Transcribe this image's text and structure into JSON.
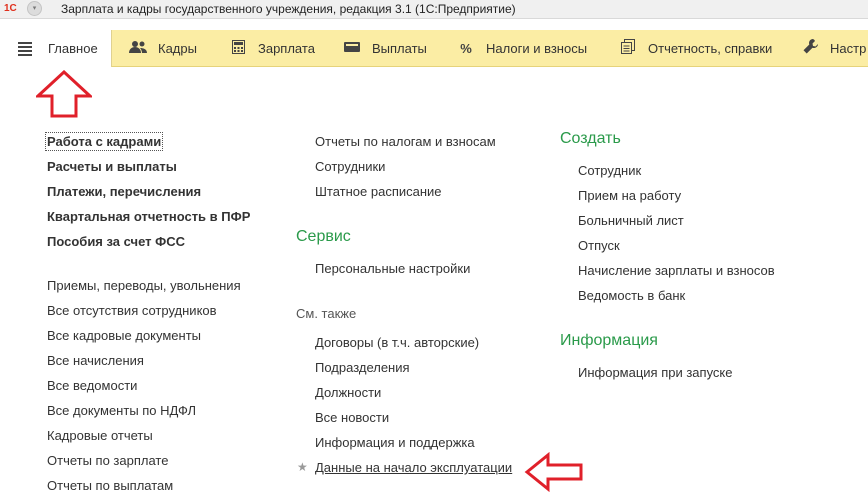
{
  "window": {
    "title": "Зарплата и кадры государственного учреждения, редакция 3.1  (1С:Предприятие)",
    "logo_text": "1С"
  },
  "sections": [
    {
      "label": "Главное",
      "icon": "menu-lines-icon"
    },
    {
      "label": "Кадры",
      "icon": "people-icon"
    },
    {
      "label": "Зарплата",
      "icon": "calculator-icon"
    },
    {
      "label": "Выплаты",
      "icon": "wallet-icon"
    },
    {
      "label": "Налоги и взносы",
      "icon": "percent-icon"
    },
    {
      "label": "Отчетность, справки",
      "icon": "reports-icon"
    },
    {
      "label": "Настр",
      "icon": "wrench-icon"
    }
  ],
  "col1": {
    "bold_items": [
      "Работа с кадрами",
      "Расчеты и выплаты",
      "Платежи, перечисления",
      "Квартальная отчетность в ПФР",
      "Пособия за счет ФСС"
    ],
    "items": [
      "Приемы, переводы, увольнения",
      "Все отсутствия сотрудников",
      "Все кадровые документы",
      "Все начисления",
      "Все ведомости",
      "Все документы по НДФЛ",
      "Кадровые отчеты",
      "Отчеты по зарплате",
      "Отчеты по выплатам"
    ]
  },
  "col2": {
    "top_items": [
      "Отчеты по налогам и взносам",
      "Сотрудники",
      "Штатное расписание"
    ],
    "service_title": "Сервис",
    "service_items": [
      "Персональные настройки"
    ],
    "see_also_title": "См. также",
    "see_also_items": [
      "Договоры (в т.ч. авторские)",
      "Подразделения",
      "Должности",
      "Все новости",
      "Информация и поддержка",
      "Данные на начало эксплуатации"
    ]
  },
  "col3": {
    "create_title": "Создать",
    "create_items": [
      "Сотрудник",
      "Прием на работу",
      "Больничный лист",
      "Отпуск",
      "Начисление зарплаты и взносов",
      "Ведомость в банк"
    ],
    "info_title": "Информация",
    "info_items": [
      "Информация при запуске"
    ]
  },
  "colors": {
    "section_bar": "#fbeda4",
    "group_title": "#2a9a4a",
    "annotation_arrow": "#e0202a"
  }
}
